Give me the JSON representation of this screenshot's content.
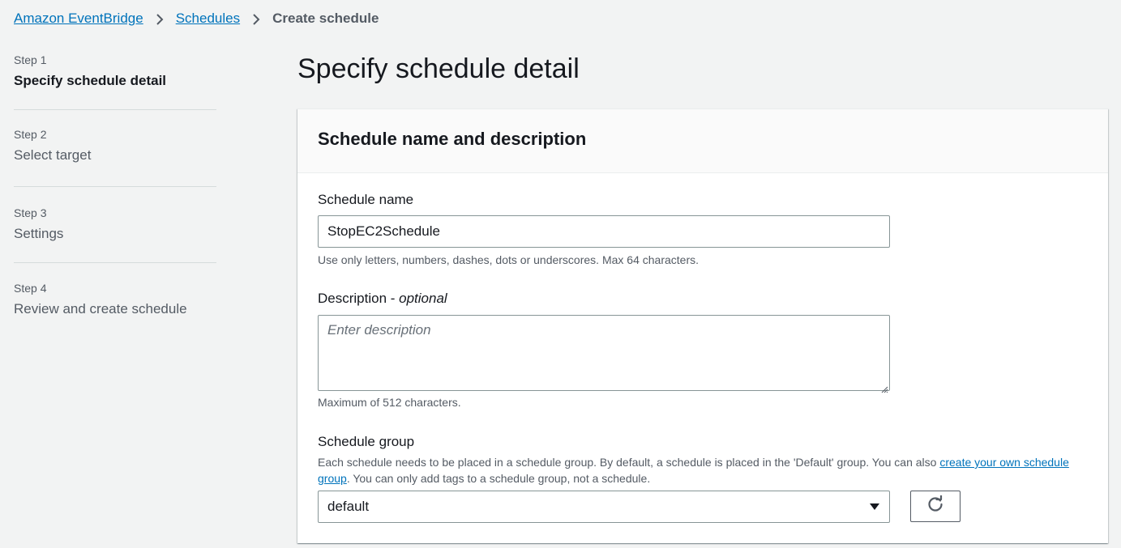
{
  "breadcrumb": {
    "items": [
      "Amazon EventBridge",
      "Schedules"
    ],
    "current": "Create schedule"
  },
  "steps": [
    {
      "num": "Step 1",
      "title": "Specify schedule detail",
      "active": true
    },
    {
      "num": "Step 2",
      "title": "Select target",
      "active": false
    },
    {
      "num": "Step 3",
      "title": "Settings",
      "active": false
    },
    {
      "num": "Step 4",
      "title": "Review and create schedule",
      "active": false
    }
  ],
  "page": {
    "title": "Specify schedule detail"
  },
  "section": {
    "title": "Schedule name and description",
    "name_label": "Schedule name",
    "name_value": "StopEC2Schedule",
    "name_hint": "Use only letters, numbers, dashes, dots or underscores. Max 64 characters.",
    "description_label": "Description - ",
    "description_optional": "optional",
    "description_placeholder": "Enter description",
    "description_hint": "Maximum of 512 characters.",
    "group_label": "Schedule group",
    "group_hint_pre": "Each schedule needs to be placed in a schedule group. By default, a schedule is placed in the 'Default' group. You can also ",
    "group_hint_link": "create your own schedule group",
    "group_hint_post": ". You can only add tags to a schedule group, not a schedule.",
    "group_value": "default"
  },
  "colors": {
    "link": "#0073bb",
    "text": "#16191f",
    "muted": "#545b64",
    "background": "#f2f3f3"
  },
  "icons": [
    "chevron-right-icon",
    "caret-down-icon",
    "refresh-icon",
    "resize-handle-icon"
  ]
}
